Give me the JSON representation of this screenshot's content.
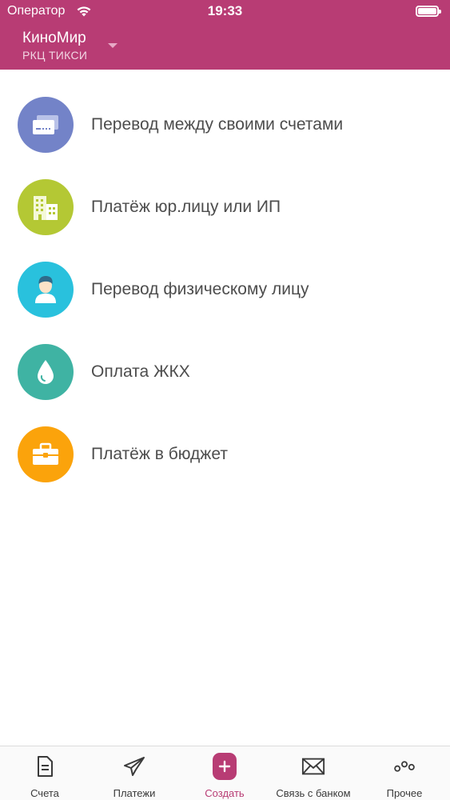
{
  "status_bar": {
    "carrier": "Оператор",
    "time": "19:33"
  },
  "header": {
    "org_name": "КиноМир",
    "org_sub": "РКЦ ТИКСИ"
  },
  "actions": [
    {
      "label": "Перевод между своими счетами",
      "icon": "cards-icon",
      "color": "#7383c8"
    },
    {
      "label": "Платёж юр.лицу или ИП",
      "icon": "buildings-icon",
      "color": "#b4c834"
    },
    {
      "label": "Перевод физическому лицу",
      "icon": "person-icon",
      "color": "#29c1dd"
    },
    {
      "label": "Оплата ЖКХ",
      "icon": "drop-icon",
      "color": "#3fb3a3"
    },
    {
      "label": "Платёж в бюджет",
      "icon": "briefcase-icon",
      "color": "#fba30b"
    }
  ],
  "tabbar": [
    {
      "label": "Счета",
      "icon": "document-icon"
    },
    {
      "label": "Платежи",
      "icon": "paper-plane-icon"
    },
    {
      "label": "Создать",
      "icon": "plus-icon",
      "active": true
    },
    {
      "label": "Связь с банком",
      "icon": "envelope-icon"
    },
    {
      "label": "Прочее",
      "icon": "more-icon"
    }
  ],
  "colors": {
    "brand": "#b83c74"
  }
}
